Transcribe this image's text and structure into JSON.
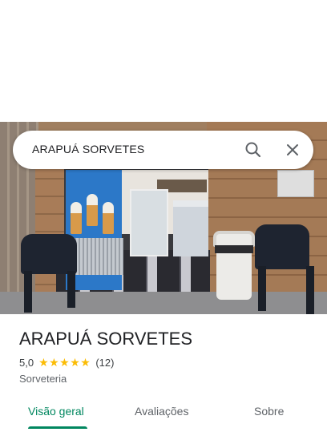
{
  "search": {
    "query": "ARAPUÁ SORVETES",
    "search_icon": "search-icon",
    "close_icon": "close-icon"
  },
  "place": {
    "name": "ARAPUÁ SORVETES",
    "rating": "5,0",
    "stars": "★★★★★",
    "review_count": "(12)",
    "category": "Sorveteria"
  },
  "tabs": [
    {
      "label": "Visão geral",
      "active": true
    },
    {
      "label": "Avaliações",
      "active": false
    },
    {
      "label": "Sobre",
      "active": false
    }
  ],
  "colors": {
    "accent": "#01875f",
    "star": "#fbbc04"
  }
}
